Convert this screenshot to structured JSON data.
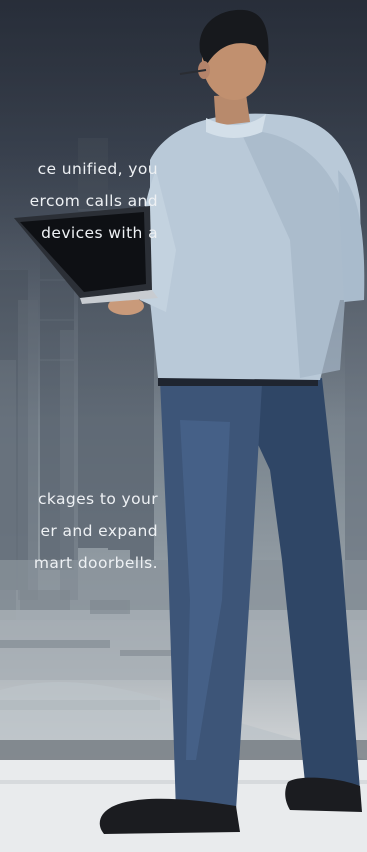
{
  "text_block_top": {
    "lines": [
      "ce unified, you",
      "ercom calls and",
      "devices with a"
    ]
  },
  "text_block_bottom": {
    "lines": [
      "ckages to your",
      "er and expand",
      "mart doorbells."
    ]
  },
  "colors": {
    "text": "#eef1f4",
    "shirt": "#b9c9d8",
    "jeans": "#3d5578",
    "floor": "#e6e8ea"
  }
}
